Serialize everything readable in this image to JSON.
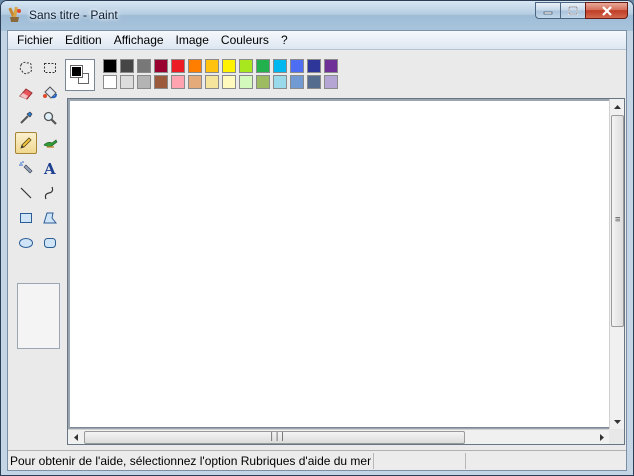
{
  "window": {
    "title": "Sans titre - Paint"
  },
  "menu": {
    "items": [
      "Fichier",
      "Edition",
      "Affichage",
      "Image",
      "Couleurs",
      "?"
    ]
  },
  "tools": [
    "free-select",
    "rect-select",
    "eraser",
    "fill",
    "color-picker",
    "magnifier",
    "pencil",
    "brush",
    "airbrush",
    "text",
    "line",
    "curve",
    "rectangle",
    "polygon",
    "ellipse",
    "rounded-rect"
  ],
  "selected_tool": "pencil",
  "palette": {
    "foreground": "#000000",
    "background": "#ffffff",
    "row1": [
      "#000000",
      "#464646",
      "#787878",
      "#990030",
      "#ed1c24",
      "#ff7e00",
      "#ffc20e",
      "#fff200",
      "#a8e61d",
      "#22b14c",
      "#00b7ef",
      "#4d6df3",
      "#2f3699",
      "#6f3198"
    ],
    "row2": [
      "#ffffff",
      "#dcdcdc",
      "#b4b4b4",
      "#9c5a3c",
      "#ffa3b1",
      "#e5aa7a",
      "#f5e49c",
      "#fff9bd",
      "#d3f9bc",
      "#9dbb61",
      "#99d9ea",
      "#709ad1",
      "#546d8e",
      "#b5a5d5"
    ]
  },
  "status": {
    "help_text": "Pour obtenir de l'aide, sélectionnez l'option Rubriques d'aide du men"
  }
}
